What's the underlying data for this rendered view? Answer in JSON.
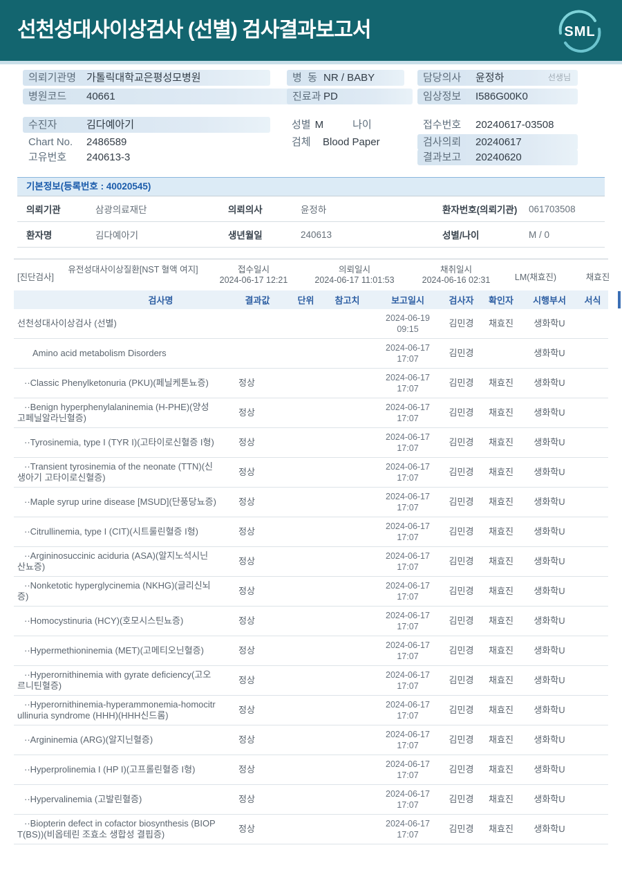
{
  "colors": {
    "header_teal": "#13656f",
    "logo_arc": "#7ed2d8",
    "accent_blue": "#1b5cab",
    "field_bar_blue": "#d5e4f0",
    "table_header_blue": "#e9f1f8"
  },
  "header": {
    "title": "선천성대사이상검사 (선별) 검사결과보고서",
    "logo_text": "SML"
  },
  "info": {
    "left": [
      {
        "label": "의뢰기관명",
        "value": "가톨릭대학교은평성모병원"
      },
      {
        "label": "병원코드",
        "value": "40661"
      },
      {
        "label": "수진자",
        "value": "김다예아기"
      },
      {
        "label": "Chart No.",
        "value": "2486589"
      },
      {
        "label": "고유번호",
        "value": "240613-3"
      }
    ],
    "middle": [
      {
        "label": "병  동",
        "value": "NR / BABY"
      },
      {
        "label": "진료과",
        "value": "PD"
      },
      {
        "label": "성별",
        "value": "M",
        "label2": "나이",
        "value2": ""
      },
      {
        "label": "검체",
        "value": "Blood Paper"
      }
    ],
    "right": [
      {
        "label": "담당의사",
        "value": "윤정하",
        "suffix": "선생님"
      },
      {
        "label": "임상정보",
        "value": "I586G00K0"
      },
      {
        "label": "접수번호",
        "value": "20240617-03508"
      },
      {
        "label": "검사의뢰",
        "value": "20240617"
      },
      {
        "label": "결과보고",
        "value": "20240620"
      }
    ]
  },
  "basic_info": {
    "title": "기본정보(등록번호 : 40020545)",
    "rows": [
      [
        {
          "label": "의뢰기관",
          "value": "삼광의료재단"
        },
        {
          "label": "의뢰의사",
          "value": "윤정하"
        },
        {
          "label": "환자번호(의뢰기관)",
          "value": "061703508"
        }
      ],
      [
        {
          "label": "환자명",
          "value": "김다예아기"
        },
        {
          "label": "생년월일",
          "value": "240613"
        },
        {
          "label": "성별/나이",
          "value": "M / 0"
        }
      ]
    ]
  },
  "diagnostic": {
    "tag": "[진단검사]",
    "test_group": "유전성대사이상질환[NST 혈액 여지]",
    "received_label": "접수일시",
    "received": "2024-06-17 12:21",
    "requested_label": "의뢰일시",
    "requested": "2024-06-17 11:01:53",
    "collected_label": "채취일시",
    "collected": "2024-06-16 02:31",
    "collector": "LM(채효진)",
    "collector2": "채효진"
  },
  "results": {
    "columns": [
      "검사명",
      "결과값",
      "단위",
      "참고치",
      "보고일시",
      "검사자",
      "확인자",
      "시행부서",
      "서식"
    ],
    "rows": [
      {
        "name": "선천성대사이상검사 (선별)",
        "indent": 0,
        "result": "",
        "date": "2024-06-19",
        "time": "09:15",
        "tester": "김민경",
        "confirmer": "채효진",
        "dept": "생화학U"
      },
      {
        "name": "Amino acid metabolism Disorders",
        "indent": 1,
        "result": "",
        "date": "2024-06-17",
        "time": "17:07",
        "tester": "김민경",
        "confirmer": "",
        "dept": "생화학U"
      },
      {
        "name": "··Classic Phenylketonuria (PKU)(페닐케톤뇨증)",
        "indent": 2,
        "result": "정상",
        "date": "2024-06-17",
        "time": "17:07",
        "tester": "김민경",
        "confirmer": "채효진",
        "dept": "생화학U"
      },
      {
        "name": "··Benign hyperphenylalaninemia (H-PHE)(양성 고페닐알라닌혈증)",
        "indent": 2,
        "result": "정상",
        "date": "2024-06-17",
        "time": "17:07",
        "tester": "김민경",
        "confirmer": "채효진",
        "dept": "생화학U"
      },
      {
        "name": "··Tyrosinemia, type I (TYR I)(고타이로신혈증 I형)",
        "indent": 2,
        "result": "정상",
        "date": "2024-06-17",
        "time": "17:07",
        "tester": "김민경",
        "confirmer": "채효진",
        "dept": "생화학U"
      },
      {
        "name": "··Transient tyrosinemia of the neonate (TTN)(신생아기 고타이로신혈증)",
        "indent": 2,
        "result": "정상",
        "date": "2024-06-17",
        "time": "17:07",
        "tester": "김민경",
        "confirmer": "채효진",
        "dept": "생화학U"
      },
      {
        "name": "··Maple syrup urine disease [MSUD](단풍당뇨증)",
        "indent": 2,
        "result": "정상",
        "date": "2024-06-17",
        "time": "17:07",
        "tester": "김민경",
        "confirmer": "채효진",
        "dept": "생화학U"
      },
      {
        "name": "··Citrullinemia, type I (CIT)(시트룰린혈증 I형)",
        "indent": 2,
        "result": "정상",
        "date": "2024-06-17",
        "time": "17:07",
        "tester": "김민경",
        "confirmer": "채효진",
        "dept": "생화학U"
      },
      {
        "name": "··Argininosuccinic aciduria (ASA)(알지노석시닌산뇨증)",
        "indent": 2,
        "result": "정상",
        "date": "2024-06-17",
        "time": "17:07",
        "tester": "김민경",
        "confirmer": "채효진",
        "dept": "생화학U"
      },
      {
        "name": "··Nonketotic hyperglycinemia (NKHG)(글리신뇌증)",
        "indent": 2,
        "result": "정상",
        "date": "2024-06-17",
        "time": "17:07",
        "tester": "김민경",
        "confirmer": "채효진",
        "dept": "생화학U"
      },
      {
        "name": "··Homocystinuria (HCY)(호모시스틴뇨증)",
        "indent": 2,
        "result": "정상",
        "date": "2024-06-17",
        "time": "17:07",
        "tester": "김민경",
        "confirmer": "채효진",
        "dept": "생화학U"
      },
      {
        "name": "··Hypermethioninemia (MET)(고메티오닌혈증)",
        "indent": 2,
        "result": "정상",
        "date": "2024-06-17",
        "time": "17:07",
        "tester": "김민경",
        "confirmer": "채효진",
        "dept": "생화학U"
      },
      {
        "name": "··Hyperornithinemia with gyrate deficiency(고오르니틴혈증)",
        "indent": 2,
        "result": "정상",
        "date": "2024-06-17",
        "time": "17:07",
        "tester": "김민경",
        "confirmer": "채효진",
        "dept": "생화학U"
      },
      {
        "name": "··Hyperornithinemia-hyperammonemia-homocitrullinuria syndrome (HHH)(HHH신드롬)",
        "indent": 2,
        "result": "정상",
        "date": "2024-06-17",
        "time": "17:07",
        "tester": "김민경",
        "confirmer": "채효진",
        "dept": "생화학U"
      },
      {
        "name": "··Argininemia (ARG)(알지닌혈증)",
        "indent": 2,
        "result": "정상",
        "date": "2024-06-17",
        "time": "17:07",
        "tester": "김민경",
        "confirmer": "채효진",
        "dept": "생화학U"
      },
      {
        "name": "··Hyperprolinemia I (HP I)(고프롤린혈증 I형)",
        "indent": 2,
        "result": "정상",
        "date": "2024-06-17",
        "time": "17:07",
        "tester": "김민경",
        "confirmer": "채효진",
        "dept": "생화학U"
      },
      {
        "name": "··Hypervalinemia (고발린혈증)",
        "indent": 2,
        "result": "정상",
        "date": "2024-06-17",
        "time": "17:07",
        "tester": "김민경",
        "confirmer": "채효진",
        "dept": "생화학U"
      },
      {
        "name": "··Biopterin defect in cofactor biosynthesis (BIOPT(BS))(비옵테린 조효소 생합성 결핍증)",
        "indent": 2,
        "result": "정상",
        "date": "2024-06-17",
        "time": "17:07",
        "tester": "김민경",
        "confirmer": "채효진",
        "dept": "생화학U"
      }
    ]
  }
}
